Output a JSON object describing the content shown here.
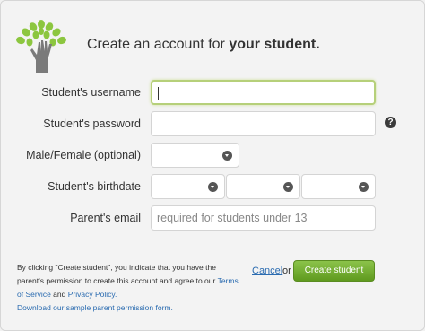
{
  "header": {
    "title_prefix": "Create an account for ",
    "title_bold": "your student."
  },
  "form": {
    "username_label": "Student's username",
    "password_label": "Student's password",
    "gender_label": "Male/Female (optional)",
    "birthdate_label": "Student's birthdate",
    "parent_email_label": "Parent's email",
    "parent_email_placeholder": "required for students under 13",
    "help_icon_glyph": "?"
  },
  "footer": {
    "notice_text": "By clicking \"Create student\", you indicate that you have the parent's permission to create this account and agree to our",
    "terms_link": "Terms of Service",
    "and_text": "and",
    "privacy_link": "Privacy Policy.",
    "download_link": "Download our sample parent permission form.",
    "cancel_label": "Cancel",
    "or_text": "or",
    "create_button": "Create student"
  },
  "colors": {
    "accent_green": "#6aa82a",
    "link_blue": "#2a6bb0",
    "focus_border": "#b6d07a"
  },
  "icons": {
    "logo": "tree-hand-logo",
    "help": "question-circle-icon",
    "dropdown": "chevron-down-circle-icon"
  }
}
